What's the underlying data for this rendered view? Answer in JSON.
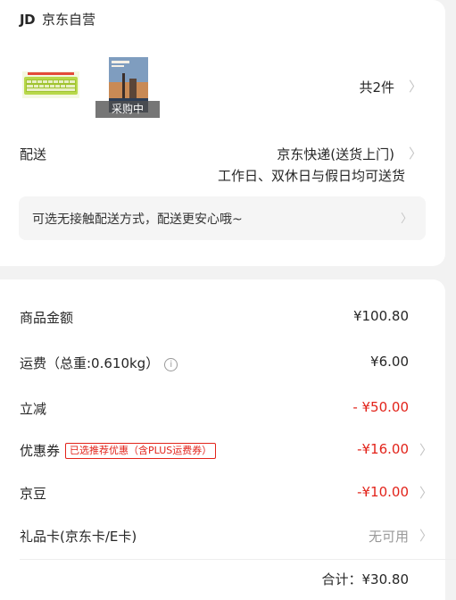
{
  "store": {
    "logo": "JD",
    "name": "京东自营"
  },
  "products": {
    "thumbs": [
      {
        "name": "keyboard-thumbnail"
      },
      {
        "name": "book-thumbnail",
        "tag": "采购中"
      }
    ],
    "count_label": "共2件"
  },
  "shipping": {
    "label": "配送",
    "method": "京东快递(送货上门)",
    "time": "工作日、双休日与假日均可送货",
    "contactless": "可选无接触配送方式，配送更安心哦~"
  },
  "summary": {
    "goods_label": "商品金额",
    "goods_value": "¥100.80",
    "freight_label": "运费（总重:0.610kg）",
    "freight_value": "¥6.00",
    "discount_label": "立减",
    "discount_value": "- ¥50.00",
    "coupon_label": "优惠券",
    "coupon_tag": "已选推荐优惠（含PLUS运费券）",
    "coupon_value": "-¥16.00",
    "beans_label": "京豆",
    "beans_value": "-¥10.00",
    "giftcard_label": "礼品卡(京东卡/E卡)",
    "giftcard_value": "无可用",
    "total": "合计：¥30.80"
  },
  "colors": {
    "accent": "#e2231a",
    "background": "#f2f2f2"
  },
  "icons": {
    "chevron": "chevron-right-icon",
    "info": "info-icon"
  }
}
